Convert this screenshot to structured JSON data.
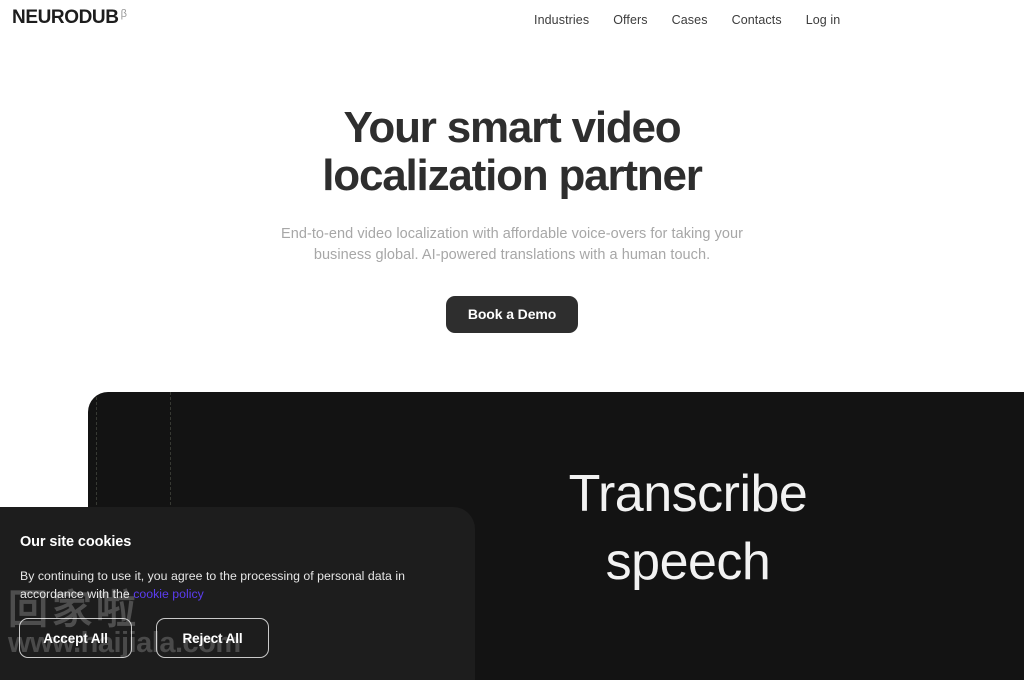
{
  "header": {
    "brand_name": "NEURODUB",
    "brand_beta": "β",
    "nav": [
      {
        "label": "Industries"
      },
      {
        "label": "Offers"
      },
      {
        "label": "Cases"
      },
      {
        "label": "Contacts"
      },
      {
        "label": "Log in"
      }
    ]
  },
  "hero": {
    "title_line1": "Your smart video",
    "title_line2": "localization partner",
    "sub_line1": "End-to-end video localization with affordable voice-overs for taking your",
    "sub_line2": "business global. AI-powered translations with a human touch.",
    "cta_label": "Book a Demo"
  },
  "showcase": {
    "caption_line1": "Transcribe",
    "caption_line2": "speech"
  },
  "cookie_banner": {
    "title": "Our site cookies",
    "text_before_link": "By continuing to use it, you agree to the processing of personal data in accordance with the ",
    "link_label": "cookie policy",
    "accept_label": "Accept All",
    "reject_label": "Reject All"
  },
  "watermark": {
    "cn_text": "回家啦",
    "url_text": "www.haijiala.com"
  },
  "colors": {
    "page_background": "#ffffff",
    "text_dark": "#2e2e2e",
    "text_muted": "#a7a7a7",
    "panel_dark": "#131313",
    "banner_dark": "#1d1d1d",
    "link_purple": "#5b3cf0",
    "cta_background": "#2e2e2e"
  }
}
